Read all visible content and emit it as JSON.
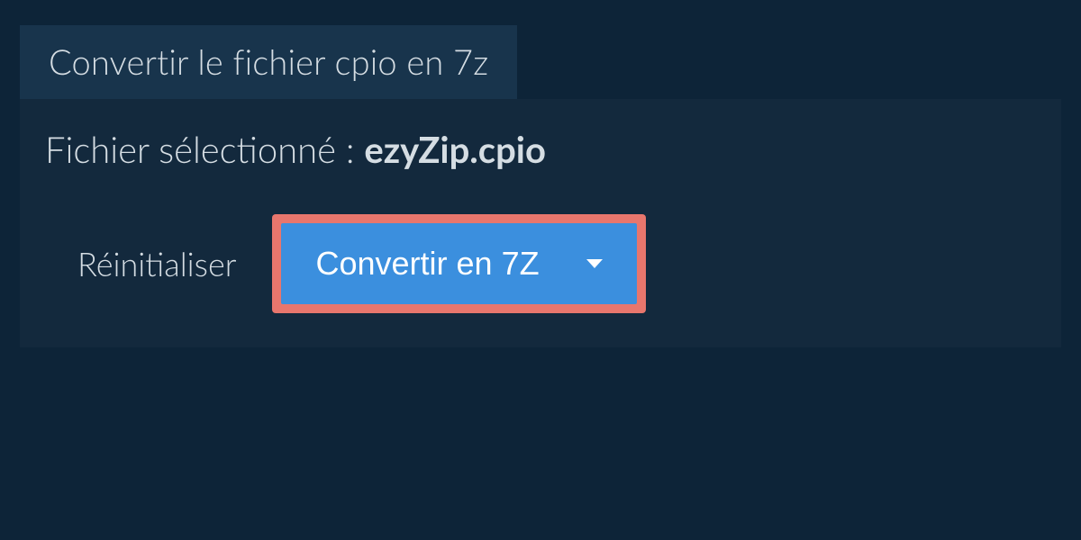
{
  "tab": {
    "label": "Convertir le fichier cpio en 7z"
  },
  "panel": {
    "selected_label": "Fichier sélectionné : ",
    "filename": "ezyZip.cpio"
  },
  "actions": {
    "reset": "Réinitialiser",
    "convert": "Convertir en 7Z"
  },
  "colors": {
    "bg": "#0d2438",
    "panel": "#13293d",
    "tab": "#18344c",
    "button": "#3b8fde",
    "highlight": "#e8766d"
  }
}
